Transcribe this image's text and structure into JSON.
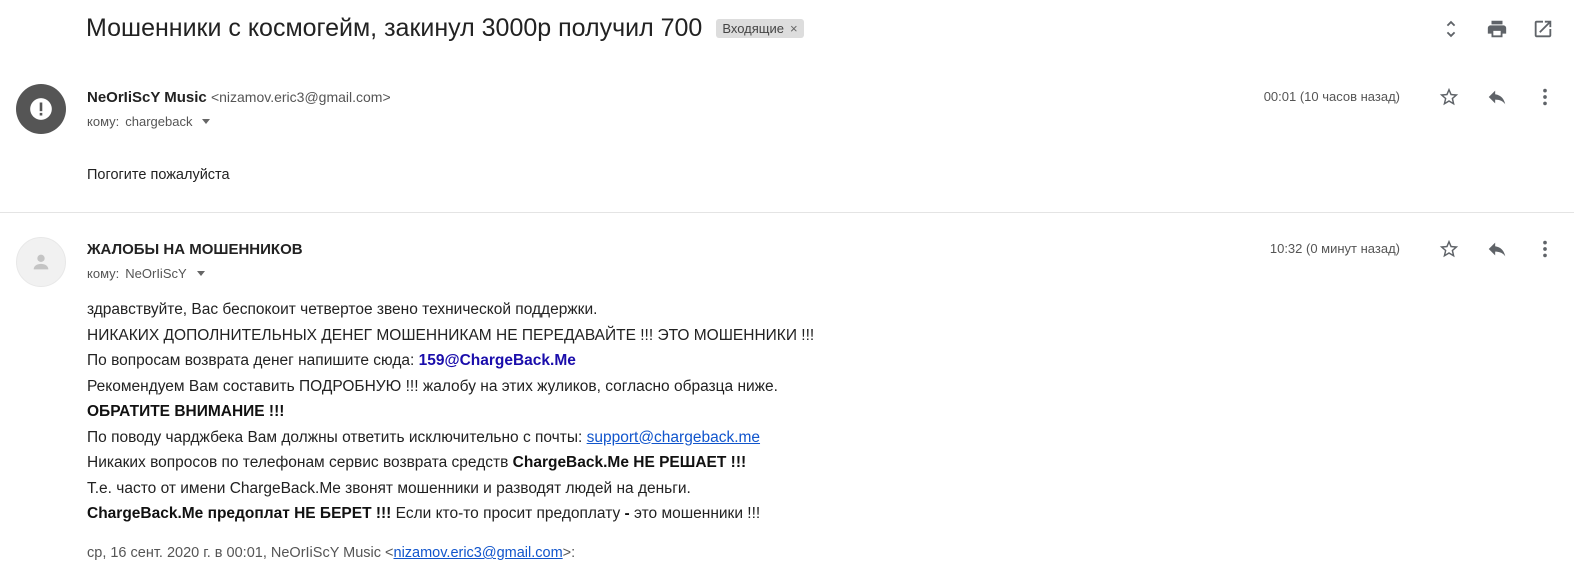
{
  "subject": "Мошенники с космогейм, закинул 3000р получил 700",
  "label": {
    "text": "Входящие",
    "close": "×"
  },
  "top_icons": [
    "expand-icon",
    "print-icon",
    "open-in-new-icon"
  ],
  "messages": [
    {
      "sender_name": "NeOrIiScY Music",
      "sender_email": "<nizamov.eric3@gmail.com>",
      "to_label": "кому:",
      "to_value": "chargeback",
      "time": "00:01 (10 часов назад)",
      "body": "Погогите пожалуйста"
    },
    {
      "sender_name": "ЖАЛОБЫ НА МОШЕННИКОВ",
      "to_label": "кому:",
      "to_value": "NeOrIiScY",
      "time": "10:32 (0 минут назад)",
      "lines": {
        "l1": "здравствуйте, Вас беспокоит четвертое звено технической поддержки.",
        "l2": "НИКАКИХ ДОПОЛНИТЕЛЬНЫХ ДЕНЕГ МОШЕННИКАМ НЕ ПЕРЕДАВАЙТЕ !!! ЭТО МОШЕННИКИ !!!",
        "l3_prefix": "По вопросам возврата денег напишите сюда: ",
        "l3_email": "159@ChargeBack.Me",
        "l4": "Рекомендуем Вам составить ПОДРОБНУЮ !!! жалобу на этих жуликов, согласно образца ниже.",
        "l5": "ОБРАТИТЕ ВНИМАНИЕ !!!",
        "l6_prefix": "По поводу чарджбека Вам должны ответить исключительно с почты: ",
        "l6_link": "support@chargeback.me",
        "l7_prefix": "Никаких вопросов по телефонам сервис возврата средств ",
        "l7_bold": "ChargeBack.Me НЕ РЕШАЕТ !!!",
        "l8": "Т.е. часто от имени ChargeBack.Me звонят мошенники и разводят людей на деньги.",
        "l9_bold1": "ChargeBack.Me предоплат НЕ БЕРЕТ !!!",
        "l9_mid": " Если кто-то просит предоплату ",
        "l9_bold2": "-",
        "l9_end": " это мошенники !!!"
      },
      "quote_prefix": "ср, 16 сент. 2020 г. в 00:01, NeOrIiScY Music <",
      "quote_email": "nizamov.eric3@gmail.com",
      "quote_suffix": ">:"
    }
  ]
}
